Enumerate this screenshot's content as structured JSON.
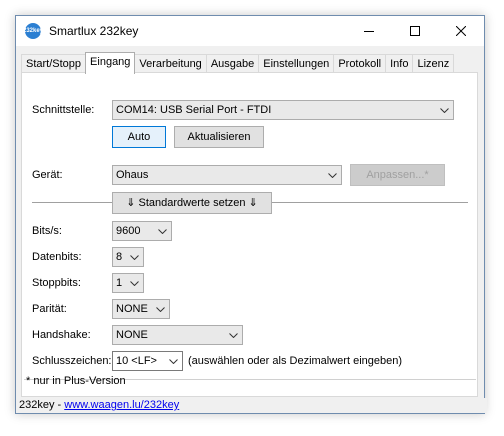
{
  "window": {
    "title": "Smartlux 232key",
    "icon_text": "232key",
    "icons": {
      "app": "app-icon",
      "minimize": "minimize-icon",
      "maximize": "maximize-icon",
      "close": "close-icon"
    }
  },
  "tabs": [
    {
      "label": "Start/Stopp",
      "active": false
    },
    {
      "label": "Eingang",
      "active": true
    },
    {
      "label": "Verarbeitung",
      "active": false
    },
    {
      "label": "Ausgabe",
      "active": false
    },
    {
      "label": "Einstellungen",
      "active": false
    },
    {
      "label": "Protokoll",
      "active": false
    },
    {
      "label": "Info",
      "active": false
    },
    {
      "label": "Lizenz",
      "active": false
    }
  ],
  "form": {
    "interface_label": "Schnittstelle:",
    "interface_value": "COM14: USB Serial Port - FTDI",
    "auto_button": "Auto",
    "refresh_button": "Aktualisieren",
    "device_label": "Gerät:",
    "device_value": "Ohaus",
    "customize_button": "Anpassen...*",
    "defaults_button": "⇓ Standardwerte setzen ⇓",
    "bits_label": "Bits/s:",
    "bits_value": "9600",
    "databits_label": "Datenbits:",
    "databits_value": "8",
    "stopbits_label": "Stoppbits:",
    "stopbits_value": "1",
    "parity_label": "Parität:",
    "parity_value": "NONE",
    "handshake_label": "Handshake:",
    "handshake_value": "NONE",
    "terminator_label": "Schlusszeichen:",
    "terminator_value": "10 <LF>",
    "terminator_hint": "(auswählen oder als Dezimalwert eingeben)",
    "footnote": "* nur in Plus-Version"
  },
  "status": {
    "prefix": "232key - ",
    "link": "www.waagen.lu/232key"
  },
  "colors": {
    "accent": "#0078d7",
    "link": "#0000ee",
    "border": "#6f8cae"
  }
}
